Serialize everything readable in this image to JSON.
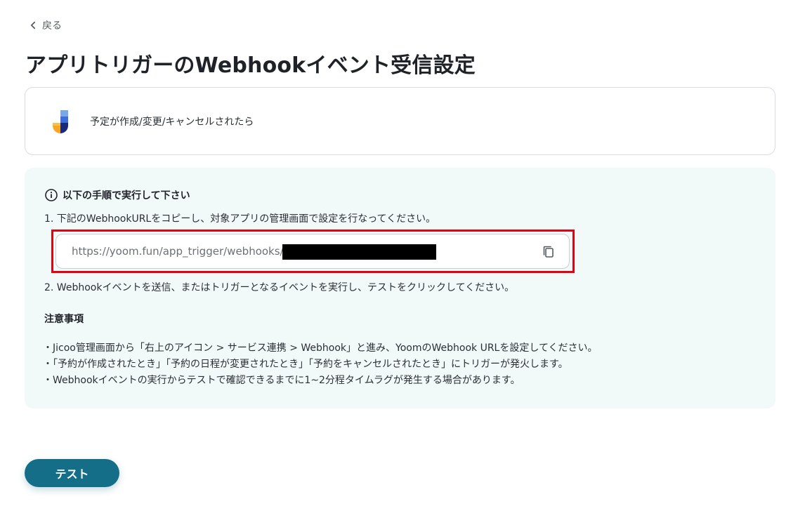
{
  "header": {
    "back_label": "戻る",
    "title": "アプリトリガーのWebhookイベント受信設定"
  },
  "trigger": {
    "app_icon": "jicoo-logo",
    "label": "予定が作成/変更/キャンセルされたら"
  },
  "instructions": {
    "heading": "以下の手順で実行して下さい",
    "step1": "1. 下記のWebhookURLをコピーし、対象アプリの管理画面で設定を行なってください。",
    "webhook_url": "https://yoom.fun/app_trigger/webhooks/",
    "step2": "2. Webhookイベントを送信、またはトリガーとなるイベントを実行し、テストをクリックしてください。",
    "notes_title": "注意事項",
    "notes": [
      "・Jicoo管理画面から「右上のアイコン > サービス連携 > Webhook」と進み、YoomのWebhook URLを設定してください。",
      "・「予約が作成されたとき」「予約の日程が変更されたとき」「予約をキャンセルされたとき」にトリガーが発火します。",
      "・Webhookイベントの実行からテストで確認できるまでに1~2分程タイムラグが発生する場合があります。"
    ]
  },
  "footer": {
    "test_label": "テスト"
  },
  "colors": {
    "primary": "#146e88",
    "highlight": "#e60012",
    "panel_bg": "#f2f9f9"
  }
}
